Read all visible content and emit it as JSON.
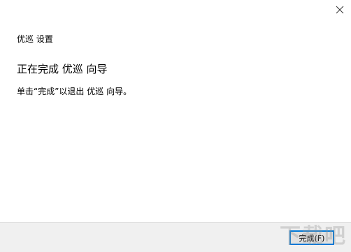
{
  "window": {
    "title": "优巡 设置",
    "close_icon": "close-icon"
  },
  "main": {
    "heading": "正在完成 优巡 向导",
    "instruction": "单击“完成”以退出 优巡 向导。"
  },
  "footer": {
    "finish_label": "完成(F)"
  },
  "watermark": {
    "text": "下载吧"
  },
  "colors": {
    "footer_background": "#f0f0f0",
    "button_focus_border": "#0078d7",
    "button_background": "#e1e1e1"
  }
}
